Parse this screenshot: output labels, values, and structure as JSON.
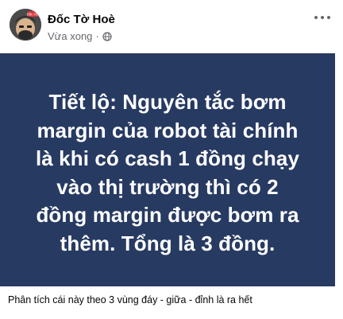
{
  "post": {
    "author": "Đốc Tờ Hoè",
    "time": "Vừa xong",
    "separator": "·",
    "privacy_icon": "globe-icon",
    "more_icon": "more-options-icon",
    "avatar_badge": "Đốc Hòe"
  },
  "banner": {
    "background_color": "#273a62",
    "text_color": "#ffffff",
    "lines": [
      "Tiết lộ: Nguyên tắc bơm",
      "margin của robot tài chính",
      "là khi có cash 1 đồng chạy",
      "vào thị trường thì có 2",
      "đồng margin được bơm ra",
      "thêm. Tổng là 3 đồng."
    ]
  },
  "caption": "Phân tích cái này theo 3 vùng đáy - giữa - đỉnh là ra hết"
}
